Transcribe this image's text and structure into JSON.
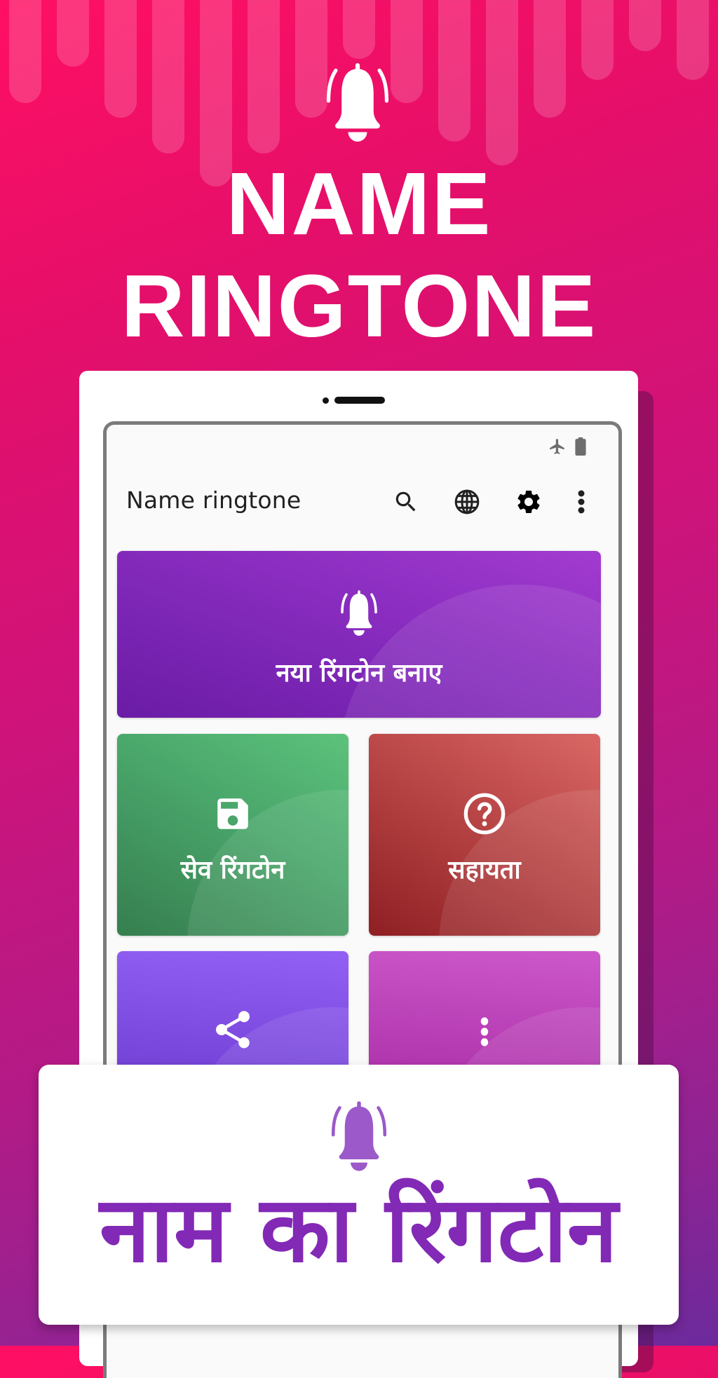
{
  "hero": {
    "title_line1": "NAME",
    "title_line2": "RINGTONE",
    "icon": "bell-ringing-icon"
  },
  "app": {
    "title": "Name ringtone",
    "status_icons": [
      "airplane-mode-icon",
      "battery-icon"
    ],
    "actions": [
      {
        "name": "search",
        "icon": "search-icon"
      },
      {
        "name": "language",
        "icon": "globe-icon"
      },
      {
        "name": "settings",
        "icon": "gear-icon"
      },
      {
        "name": "more",
        "icon": "more-vert-icon"
      }
    ]
  },
  "tiles": {
    "create": {
      "label": "नया रिंगटोन बनाए",
      "icon": "bell-ringing-icon",
      "color": "#8a2dc0"
    },
    "saved": {
      "label": "सेव रिंगटोन",
      "icon": "save-icon",
      "color": "#49a56a"
    },
    "help": {
      "label": "सहायता",
      "icon": "help-circle-icon",
      "color": "#b94646"
    },
    "share": {
      "label": "",
      "icon": "share-icon",
      "color": "#7a48dd"
    },
    "more": {
      "label": "",
      "icon": "more-vert-icon",
      "color": "#b53bb2"
    }
  },
  "promo": {
    "title": "नाम का रिंगटोन",
    "icon": "bell-ringing-icon",
    "accent": "#8229b6"
  },
  "colors": {
    "background_top": "#ff0f63",
    "background_bottom": "#6b2a9c"
  }
}
